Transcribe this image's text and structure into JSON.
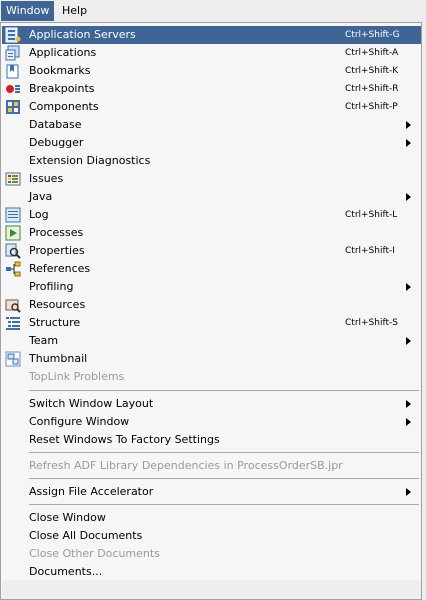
{
  "menubar": {
    "window": "Window",
    "help": "Help"
  },
  "menu": {
    "items": [
      {
        "label": "Application Servers",
        "shortcut": "Ctrl+Shift-G",
        "icon": "application-servers-icon",
        "selected": true
      },
      {
        "label": "Applications",
        "shortcut": "Ctrl+Shift-A",
        "icon": "applications-icon"
      },
      {
        "label": "Bookmarks",
        "shortcut": "Ctrl+Shift-K",
        "icon": "bookmarks-icon"
      },
      {
        "label": "Breakpoints",
        "shortcut": "Ctrl+Shift-R",
        "icon": "breakpoints-icon"
      },
      {
        "label": "Components",
        "shortcut": "Ctrl+Shift-P",
        "icon": "components-icon"
      },
      {
        "label": "Database",
        "submenu": true
      },
      {
        "label": "Debugger",
        "submenu": true
      },
      {
        "label": "Extension Diagnostics"
      },
      {
        "label": "Issues",
        "icon": "issues-icon"
      },
      {
        "label": "Java",
        "submenu": true
      },
      {
        "label": "Log",
        "shortcut": "Ctrl+Shift-L",
        "icon": "log-icon"
      },
      {
        "label": "Processes",
        "icon": "processes-icon"
      },
      {
        "label": "Properties",
        "shortcut": "Ctrl+Shift-I",
        "icon": "properties-icon"
      },
      {
        "label": "References",
        "icon": "references-icon"
      },
      {
        "label": "Profiling",
        "submenu": true
      },
      {
        "label": "Resources",
        "icon": "resources-icon"
      },
      {
        "label": "Structure",
        "shortcut": "Ctrl+Shift-S",
        "icon": "structure-icon"
      },
      {
        "label": "Team",
        "submenu": true
      },
      {
        "label": "Thumbnail",
        "icon": "thumbnail-icon"
      },
      {
        "label": "TopLink Problems",
        "disabled": true
      },
      {
        "label": "Switch Window Layout",
        "submenu": true
      },
      {
        "label": "Configure Window",
        "submenu": true
      },
      {
        "label": "Reset Windows To Factory Settings"
      },
      {
        "label": "Refresh ADF Library Dependencies in ProcessOrderSB.jpr",
        "disabled": true
      },
      {
        "label": "Assign File Accelerator",
        "submenu": true
      },
      {
        "label": "Close Window"
      },
      {
        "label": "Close All Documents"
      },
      {
        "label": "Close Other Documents",
        "disabled": true
      },
      {
        "label": "Documents..."
      }
    ]
  },
  "colors": {
    "selection": "#3e6595",
    "menu_background": "#f6f6f6",
    "disabled_text": "#9a9a9a"
  }
}
